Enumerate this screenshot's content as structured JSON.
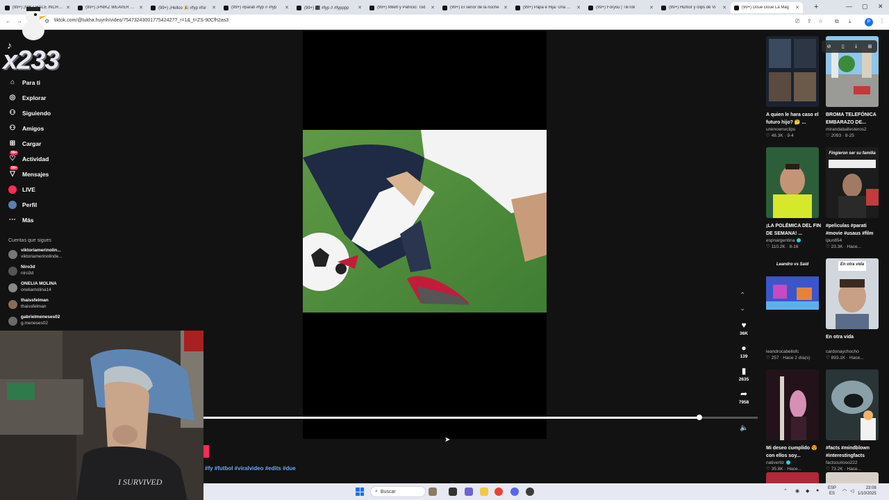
{
  "browser": {
    "tabs": [
      {
        "label": "(99+) ¡NIKZ HACE INCREÍB"
      },
      {
        "label": "(99+) ¡PNIKZ WEAVER SUP"
      },
      {
        "label": "(99+) ¡Helloo 🎉 #fyp #for"
      },
      {
        "label": "(99+) #parati #fyp // #fyp"
      },
      {
        "label": "(99+) ⬛ #fyp // #fypppp"
      },
      {
        "label": "(99+) Milett y Patricio: Tod"
      },
      {
        "label": "(99+) El señor de la noche"
      },
      {
        "label": "(99+) Papa e Hija: Una Hist"
      },
      {
        "label": "(99+) Foryou | TikTok"
      },
      {
        "label": "(99+) Humor y clips de Vi"
      },
      {
        "label": "(99+) Doue Doue La Mag"
      }
    ],
    "active_tab_index": 10,
    "new_tab": "+",
    "url": "tiktok.com/@tukha.huynh/video/7547324300177542427?_r=1&_t=ZS-90Cfh2as3",
    "profile_initial": "P"
  },
  "overlay_text": "x233",
  "nav": {
    "items": [
      {
        "label": "Para ti",
        "icon": "home-icon",
        "glyph": "⌂"
      },
      {
        "label": "Explorar",
        "icon": "compass-icon",
        "glyph": "◎"
      },
      {
        "label": "Siguiendo",
        "icon": "following-icon",
        "glyph": "⚇"
      },
      {
        "label": "Amigos",
        "icon": "friends-icon",
        "glyph": "⚇"
      },
      {
        "label": "Cargar",
        "icon": "upload-icon",
        "glyph": "⊞"
      },
      {
        "label": "Actividad",
        "icon": "activity-icon",
        "glyph": "♡",
        "badge": "99+"
      },
      {
        "label": "Mensajes",
        "icon": "messages-icon",
        "glyph": "▽",
        "badge": "99+"
      },
      {
        "label": "LIVE",
        "icon": "live-icon",
        "glyph": ""
      },
      {
        "label": "Perfil",
        "icon": "profile-icon",
        "glyph": ""
      },
      {
        "label": "Más",
        "icon": "more-icon",
        "glyph": "···"
      }
    ],
    "following_heading": "Cuentas que sigues",
    "accounts": [
      {
        "name": "viktoriamerinolin...",
        "handle": "viktoriamerinolinde..."
      },
      {
        "name": "Niro3d",
        "handle": "niro3d"
      },
      {
        "name": "ONELIA MOLINA",
        "handle": "oneliamolina14"
      },
      {
        "name": "thaissfelman",
        "handle": "thaissfelman"
      },
      {
        "name": "gabrielmeneses02",
        "handle": "g.meneses02"
      }
    ]
  },
  "video": {
    "progress": 0.895,
    "hashtags": "#fy #futbol #viralvideo #edits #due"
  },
  "actions": {
    "likes": "36K",
    "comments": "139",
    "saves": "2635",
    "shares": "7958"
  },
  "sidebar": {
    "cards": [
      {
        "caption": "A quien le hara caso el futuro hijo? 🤔 ...",
        "author": "unknownxclips",
        "stats": "♡ 48.3K · 9-4",
        "verified": false,
        "thumb": "stills"
      },
      {
        "caption": "BROMA TELEFÓNICA EMBARAZO DE...",
        "author": "mirandaballesteros2",
        "stats": "♡ 2093 · 8-25",
        "verified": false,
        "thumb": "street"
      },
      {
        "caption": "¡LA POLÉMICA DEL FIN DE SEMANA! ...",
        "author": "espnargentina",
        "stats": "♡ 110.2K · 8-16",
        "verified": true,
        "thumb": "player"
      },
      {
        "caption": "#peliculas #parati #movie #usaus #film",
        "author": "ipun854",
        "stats": "♡ 23.3K · Hace...",
        "verified": false,
        "thumb": "movie",
        "overlay": "Fingieron ser su familia"
      },
      {
        "caption": "",
        "author": "leandrocabellofc",
        "stats": "♡ 257 · Hace 2 día(s)",
        "verified": false,
        "thumb": "game",
        "overlay": "Leandro vs Said"
      },
      {
        "caption": "En otra vida",
        "author": "cardonaychocho",
        "stats": "♡ 893.1K · Hace...",
        "verified": false,
        "thumb": "kid",
        "overlay": "En otra vida"
      },
      {
        "caption": "Mi deseo cumplido 😍 con ellos soy...",
        "author": "nativertiz",
        "stats": "♡ 35.8K · Hace...",
        "verified": true,
        "thumb": "stage"
      },
      {
        "caption": "#facts #mindblown #interestingfacts",
        "author": "factscurioso222",
        "stats": "♡ 73.2K · Hace...",
        "verified": false,
        "thumb": "facts"
      }
    ]
  },
  "taskbar": {
    "search_label": "Buscar",
    "lang_line1": "ESP",
    "lang_line2": "ES",
    "time": "23:08",
    "date": "1/10/2025"
  }
}
